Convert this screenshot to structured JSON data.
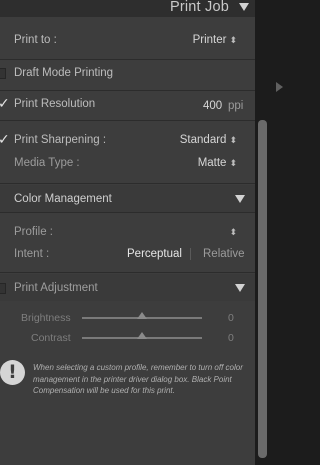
{
  "header": {
    "title": "Print Job"
  },
  "print_to": {
    "label": "Print to :",
    "value": "Printer"
  },
  "draft_mode": {
    "label": "Draft Mode Printing",
    "checked": false
  },
  "print_resolution": {
    "label": "Print Resolution",
    "value": "400",
    "unit": "ppi",
    "checked": true
  },
  "print_sharpening": {
    "label": "Print Sharpening :",
    "value": "Standard",
    "checked": true
  },
  "media_type": {
    "label": "Media Type :",
    "value": "Matte"
  },
  "color_management": {
    "title": "Color Management",
    "profile_label": "Profile :",
    "intent_label": "Intent :",
    "intent_options": [
      "Perceptual",
      "Relative"
    ],
    "intent_selected": "Perceptual"
  },
  "print_adjustment": {
    "title": "Print Adjustment",
    "checked": false,
    "brightness": {
      "label": "Brightness",
      "value": "0",
      "level": 0.5
    },
    "contrast": {
      "label": "Contrast",
      "value": "0",
      "level": 0.5
    }
  },
  "note": "When selecting a custom profile, remember to turn off color management in the printer driver dialog box. Black Point Compensation will be used for this print.",
  "colors": {
    "panel": "#3d3d3d",
    "header": "#2e2e2e",
    "text": "#bdbdbd",
    "value": "#d6d6d6"
  }
}
